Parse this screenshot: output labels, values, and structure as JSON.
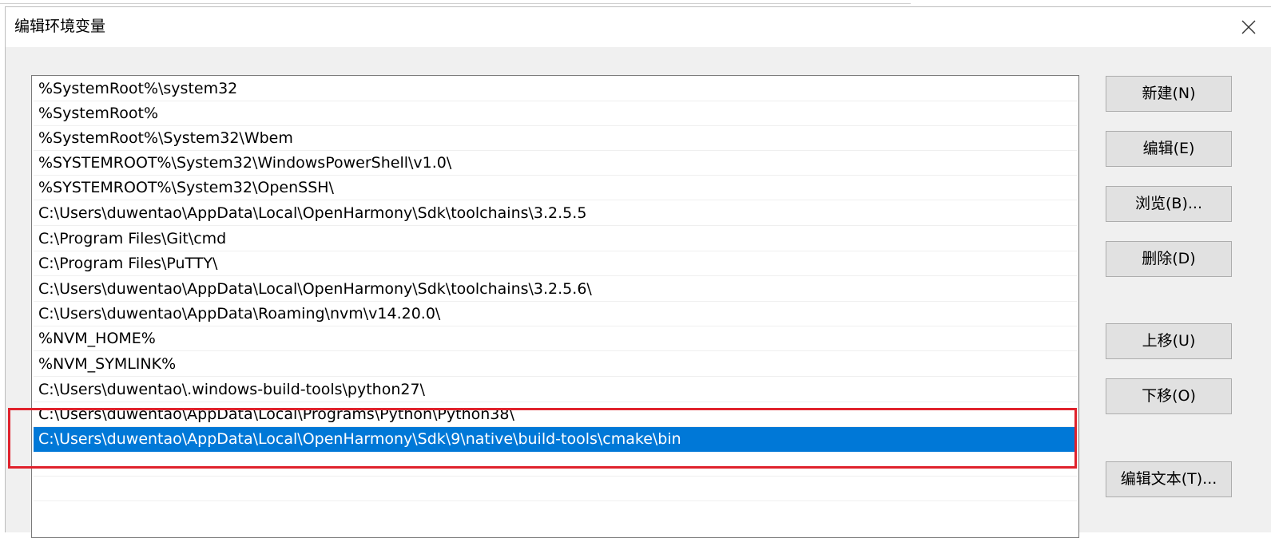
{
  "window": {
    "title": "编辑环境变量",
    "close_icon": "close-icon"
  },
  "path_list": {
    "items": [
      "%SystemRoot%\\system32",
      "%SystemRoot%",
      "%SystemRoot%\\System32\\Wbem",
      "%SYSTEMROOT%\\System32\\WindowsPowerShell\\v1.0\\",
      "%SYSTEMROOT%\\System32\\OpenSSH\\",
      "C:\\Users\\duwentao\\AppData\\Local\\OpenHarmony\\Sdk\\toolchains\\3.2.5.5",
      "C:\\Program Files\\Git\\cmd",
      "C:\\Program Files\\PuTTY\\",
      "C:\\Users\\duwentao\\AppData\\Local\\OpenHarmony\\Sdk\\toolchains\\3.2.5.6\\",
      "C:\\Users\\duwentao\\AppData\\Roaming\\nvm\\v14.20.0\\",
      "%NVM_HOME%",
      "%NVM_SYMLINK%",
      "C:\\Users\\duwentao\\.windows-build-tools\\python27\\",
      "C:\\Users\\duwentao\\AppData\\Local\\Programs\\Python\\Python38\\",
      "C:\\Users\\duwentao\\AppData\\Local\\OpenHarmony\\Sdk\\9\\native\\build-tools\\cmake\\bin"
    ],
    "selected_index": 14
  },
  "buttons": {
    "new": "新建(N)",
    "edit": "编辑(E)",
    "browse": "浏览(B)...",
    "delete": "删除(D)",
    "move_up": "上移(U)",
    "move_down": "下移(O)",
    "edit_text": "编辑文本(T)..."
  },
  "colors": {
    "selection": "#0078d7",
    "annotation_box": "#e0222c"
  }
}
